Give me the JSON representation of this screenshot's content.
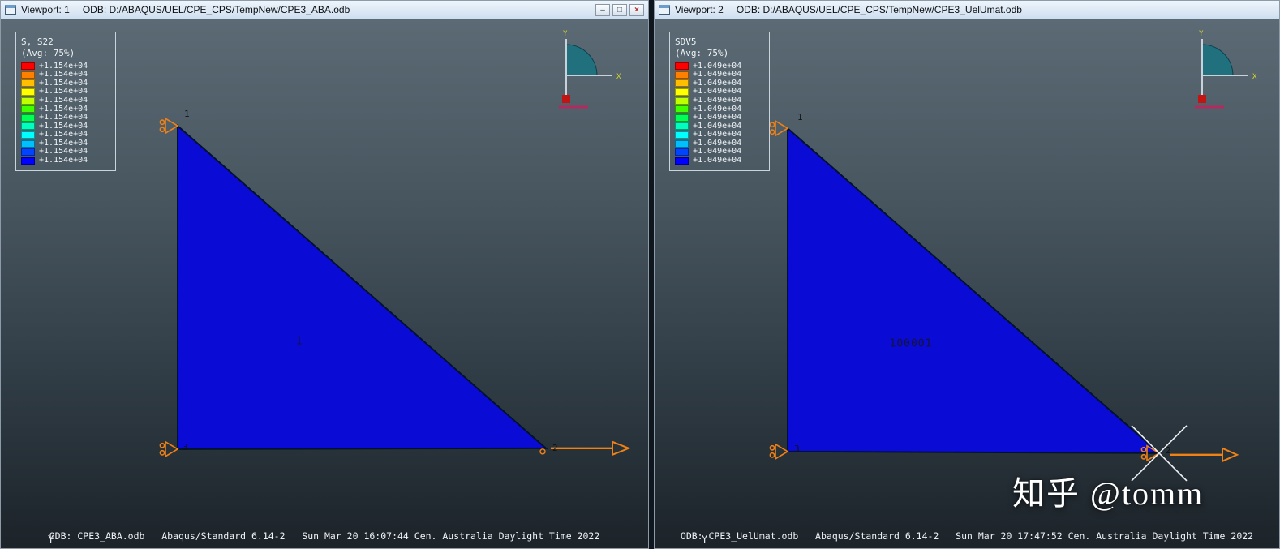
{
  "colors": {
    "element_fill": "#0b0bd6",
    "element_edge": "#00122e",
    "bc_symbol": "#f08114",
    "triad_sector": "#20707e"
  },
  "legend_colors": [
    "#ff0000",
    "#ff8000",
    "#ffbf00",
    "#ffff00",
    "#bfff00",
    "#40ff00",
    "#00ff55",
    "#00ffbf",
    "#00ffff",
    "#00bfff",
    "#0044ff",
    "#0000ff"
  ],
  "watermark": "知乎 @tomm",
  "viewports": [
    {
      "title": "Viewport: 1",
      "odb_path": "ODB: D:/ABAQUS/UEL/CPE_CPS/TempNew/CPE3_ABA.odb",
      "window_buttons": {
        "minimize": "–",
        "maximize": "□",
        "close": "×"
      },
      "legend": {
        "title": "S, S22",
        "subtitle": "(Avg: 75%)",
        "values": [
          "+1.154e+04",
          "+1.154e+04",
          "+1.154e+04",
          "+1.154e+04",
          "+1.154e+04",
          "+1.154e+04",
          "+1.154e+04",
          "+1.154e+04",
          "+1.154e+04",
          "+1.154e+04",
          "+1.154e+04",
          "+1.154e+04"
        ]
      },
      "triad": {
        "x_label": "X",
        "y_label": "Y"
      },
      "element_label": "1",
      "node_labels": {
        "n1": "1",
        "n2": "2",
        "n3": "3"
      },
      "axis_label": "Y",
      "status_line": "ODB: CPE3_ABA.odb   Abaqus/Standard 6.14-2   Sun Mar 20 16:07:44 Cen. Australia Daylight Time 2022"
    },
    {
      "title": "Viewport: 2",
      "odb_path": "ODB: D:/ABAQUS/UEL/CPE_CPS/TempNew/CPE3_UelUmat.odb",
      "legend": {
        "title": "SDV5",
        "subtitle": "(Avg: 75%)",
        "values": [
          "+1.049e+04",
          "+1.049e+04",
          "+1.049e+04",
          "+1.049e+04",
          "+1.049e+04",
          "+1.049e+04",
          "+1.049e+04",
          "+1.049e+04",
          "+1.049e+04",
          "+1.049e+04",
          "+1.049e+04",
          "+1.049e+04"
        ]
      },
      "triad": {
        "x_label": "X",
        "y_label": "Y"
      },
      "element_label": "100001",
      "node_labels": {
        "n1": "1",
        "n2": "2",
        "n3": "3"
      },
      "axis_label": "Y",
      "status_line": "ODB: CPE3_UelUmat.odb   Abaqus/Standard 6.14-2   Sun Mar 20 17:47:52 Cen. Australia Daylight Time 2022"
    }
  ]
}
